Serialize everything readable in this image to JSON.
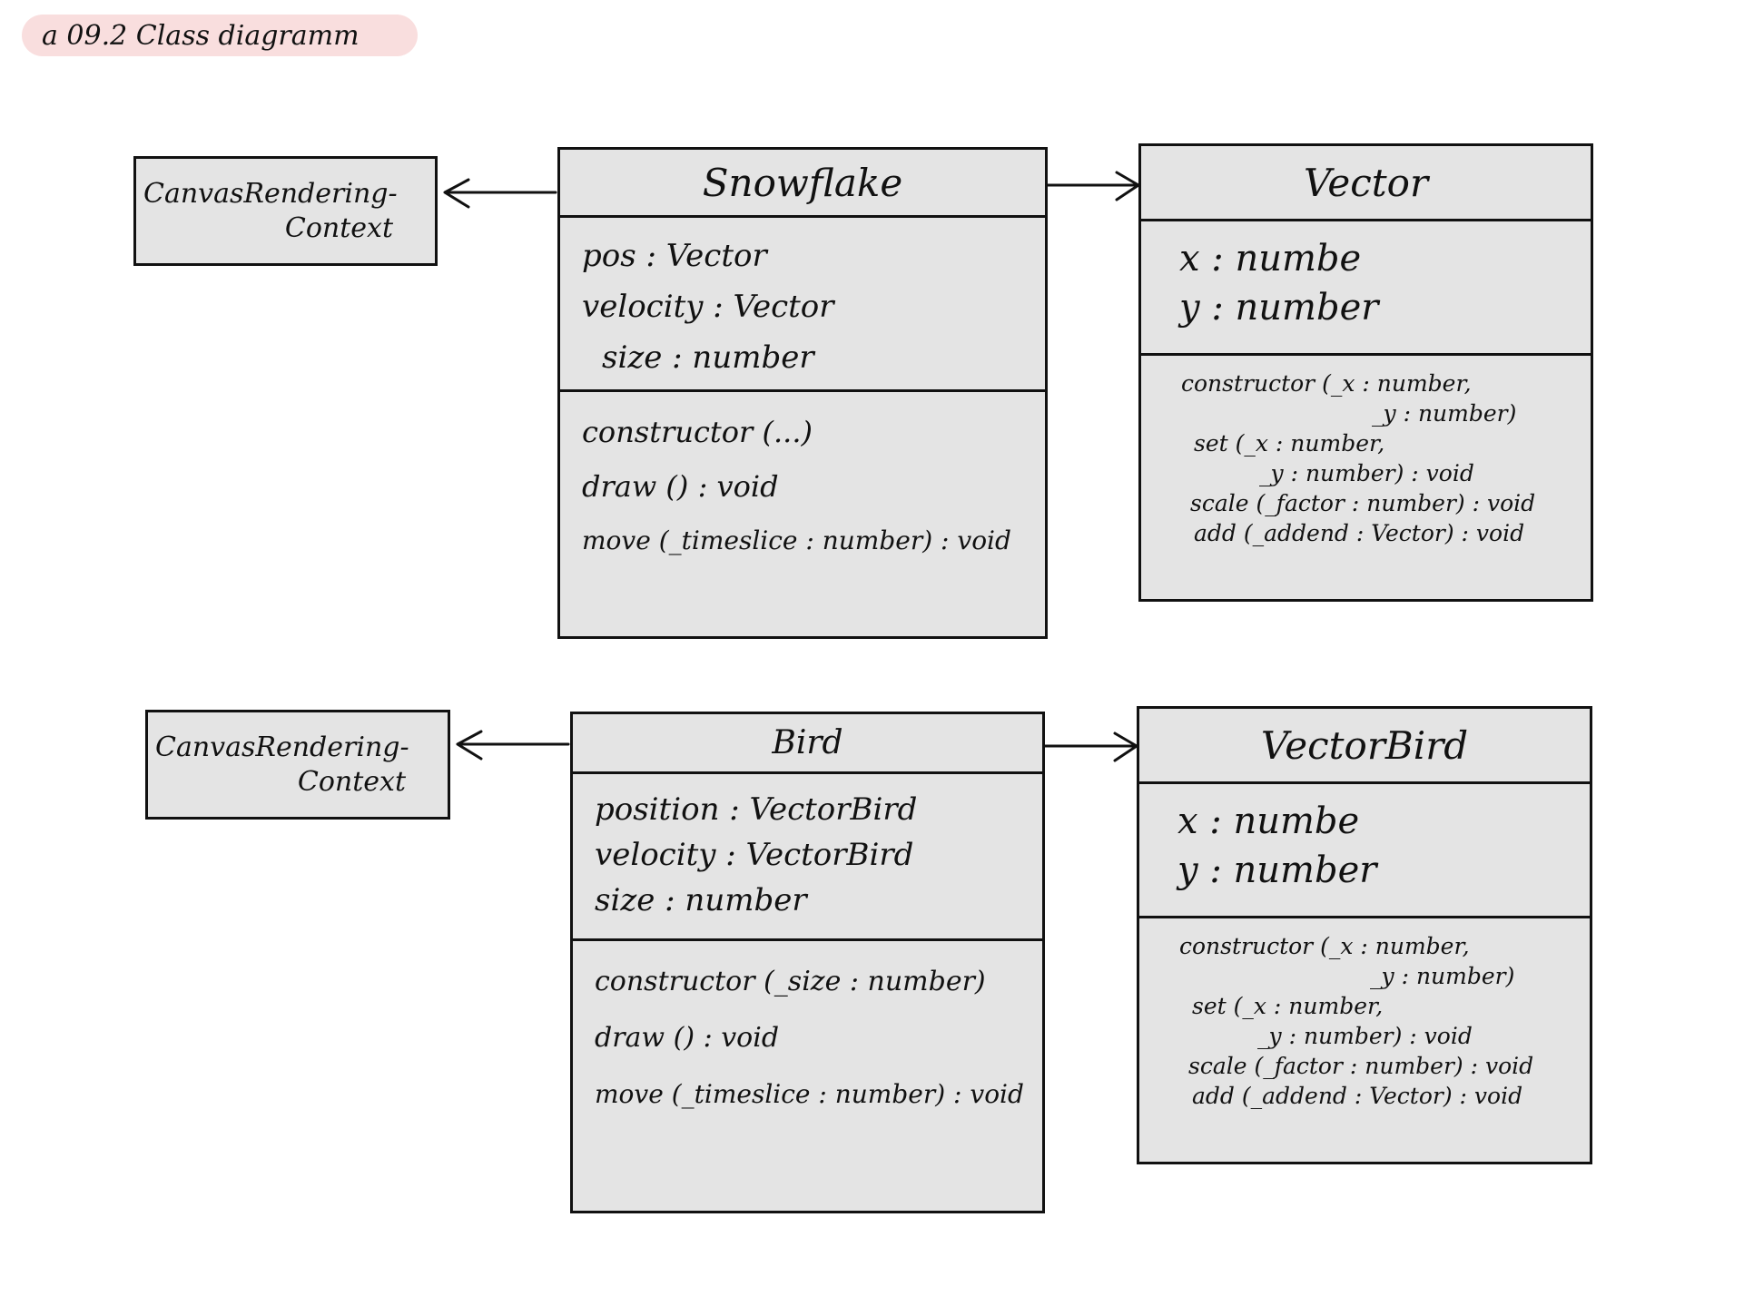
{
  "page_title": "a 09.2 Class diagramm",
  "diagram1": {
    "context": {
      "line1": "CanvasRendering-",
      "line2": "Context"
    },
    "main": {
      "name": "Snowflake",
      "attributes": [
        "pos : Vector",
        "velocity : Vector",
        "size : number"
      ],
      "methods": [
        "constructor (...)",
        "draw () : void",
        "move (_timeslice : number) : void"
      ]
    },
    "vector": {
      "name": "Vector",
      "attributes": [
        "x : numbe",
        "y : number"
      ],
      "methods": [
        "constructor (_x : number,",
        "_y : number)",
        "set (_x : number,",
        "_y : number) : void",
        "scale (_factor : number) : void",
        "add (_addend : Vector) : void"
      ]
    }
  },
  "diagram2": {
    "context": {
      "line1": "CanvasRendering-",
      "line2": "Context"
    },
    "main": {
      "name": "Bird",
      "attributes": [
        "position : VectorBird",
        "velocity : VectorBird",
        "size : number"
      ],
      "methods": [
        "constructor (_size : number)",
        "draw () : void",
        "move (_timeslice : number) : void"
      ]
    },
    "vector": {
      "name": "VectorBird",
      "attributes": [
        "x : numbe",
        "y : number"
      ],
      "methods": [
        "constructor (_x : number,",
        "_y : number)",
        "set (_x : number,",
        "_y : number) : void",
        "scale (_factor : number) : void",
        "add (_addend : Vector) : void"
      ]
    }
  }
}
